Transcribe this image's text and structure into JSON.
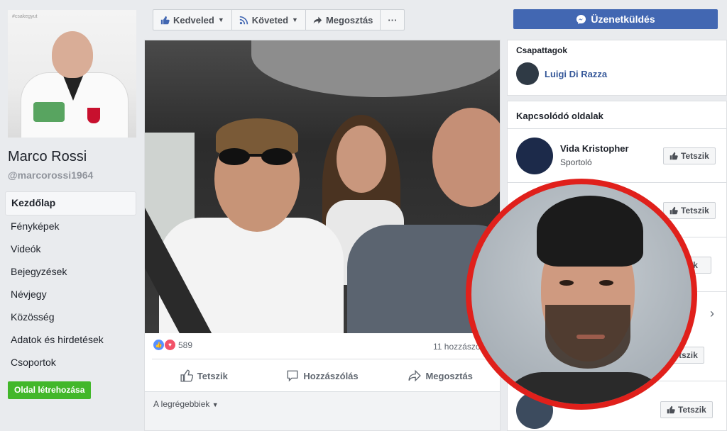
{
  "profile": {
    "photo_tag": "#csakegyut",
    "name": "Marco Rossi",
    "handle": "@marcorossi1964"
  },
  "nav": {
    "items": [
      {
        "label": "Kezdőlap",
        "active": true
      },
      {
        "label": "Fényképek"
      },
      {
        "label": "Videók"
      },
      {
        "label": "Bejegyzések"
      },
      {
        "label": "Névjegy"
      },
      {
        "label": "Közösség"
      },
      {
        "label": "Adatok és hirdetések"
      },
      {
        "label": "Csoportok"
      }
    ],
    "create_page": "Oldal létrehozása"
  },
  "actions": {
    "like": "Kedveled",
    "follow": "Követed",
    "share": "Megosztás",
    "more": "···",
    "message": "Üzenetküldés"
  },
  "post": {
    "reactions_count": "589",
    "comments_count": "11 hozzászó",
    "like": "Tetszik",
    "comment": "Hozzászólás",
    "share": "Megosztás",
    "sort": "A legrégebbiek"
  },
  "sidebar": {
    "teammates_title": "Csapattagok",
    "teammate_name": "Luigi Di Razza",
    "related_title": "Kapcsolódó oldalak",
    "related": [
      {
        "name": "Vida Kristopher",
        "category": "Sportoló",
        "button": "Tetszik"
      }
    ],
    "like_button": "Tetszik"
  },
  "colors": {
    "fb_blue": "#4267b2",
    "link_blue": "#365899",
    "green": "#42b72a",
    "overlay_ring": "#e0201b"
  }
}
